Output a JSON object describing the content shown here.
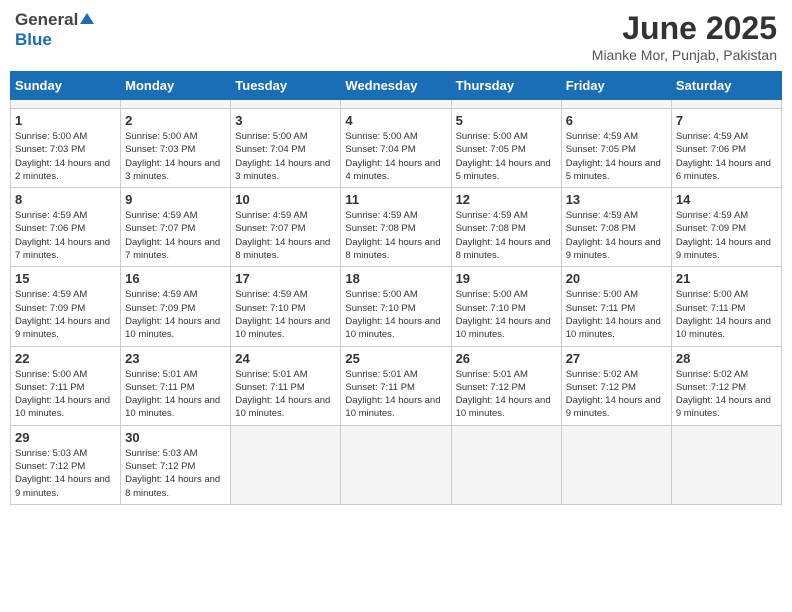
{
  "header": {
    "logo_general": "General",
    "logo_blue": "Blue",
    "month_title": "June 2025",
    "location": "Mianke Mor, Punjab, Pakistan"
  },
  "calendar": {
    "days_of_week": [
      "Sunday",
      "Monday",
      "Tuesday",
      "Wednesday",
      "Thursday",
      "Friday",
      "Saturday"
    ],
    "weeks": [
      [
        {
          "day": null,
          "empty": true
        },
        {
          "day": null,
          "empty": true
        },
        {
          "day": null,
          "empty": true
        },
        {
          "day": null,
          "empty": true
        },
        {
          "day": null,
          "empty": true
        },
        {
          "day": null,
          "empty": true
        },
        {
          "day": null,
          "empty": true
        }
      ],
      [
        {
          "day": 1,
          "sunrise": "5:00 AM",
          "sunset": "7:03 PM",
          "daylight": "14 hours and 2 minutes."
        },
        {
          "day": 2,
          "sunrise": "5:00 AM",
          "sunset": "7:03 PM",
          "daylight": "14 hours and 3 minutes."
        },
        {
          "day": 3,
          "sunrise": "5:00 AM",
          "sunset": "7:04 PM",
          "daylight": "14 hours and 3 minutes."
        },
        {
          "day": 4,
          "sunrise": "5:00 AM",
          "sunset": "7:04 PM",
          "daylight": "14 hours and 4 minutes."
        },
        {
          "day": 5,
          "sunrise": "5:00 AM",
          "sunset": "7:05 PM",
          "daylight": "14 hours and 5 minutes."
        },
        {
          "day": 6,
          "sunrise": "4:59 AM",
          "sunset": "7:05 PM",
          "daylight": "14 hours and 5 minutes."
        },
        {
          "day": 7,
          "sunrise": "4:59 AM",
          "sunset": "7:06 PM",
          "daylight": "14 hours and 6 minutes."
        }
      ],
      [
        {
          "day": 8,
          "sunrise": "4:59 AM",
          "sunset": "7:06 PM",
          "daylight": "14 hours and 7 minutes."
        },
        {
          "day": 9,
          "sunrise": "4:59 AM",
          "sunset": "7:07 PM",
          "daylight": "14 hours and 7 minutes."
        },
        {
          "day": 10,
          "sunrise": "4:59 AM",
          "sunset": "7:07 PM",
          "daylight": "14 hours and 8 minutes."
        },
        {
          "day": 11,
          "sunrise": "4:59 AM",
          "sunset": "7:08 PM",
          "daylight": "14 hours and 8 minutes."
        },
        {
          "day": 12,
          "sunrise": "4:59 AM",
          "sunset": "7:08 PM",
          "daylight": "14 hours and 8 minutes."
        },
        {
          "day": 13,
          "sunrise": "4:59 AM",
          "sunset": "7:08 PM",
          "daylight": "14 hours and 9 minutes."
        },
        {
          "day": 14,
          "sunrise": "4:59 AM",
          "sunset": "7:09 PM",
          "daylight": "14 hours and 9 minutes."
        }
      ],
      [
        {
          "day": 15,
          "sunrise": "4:59 AM",
          "sunset": "7:09 PM",
          "daylight": "14 hours and 9 minutes."
        },
        {
          "day": 16,
          "sunrise": "4:59 AM",
          "sunset": "7:09 PM",
          "daylight": "14 hours and 10 minutes."
        },
        {
          "day": 17,
          "sunrise": "4:59 AM",
          "sunset": "7:10 PM",
          "daylight": "14 hours and 10 minutes."
        },
        {
          "day": 18,
          "sunrise": "5:00 AM",
          "sunset": "7:10 PM",
          "daylight": "14 hours and 10 minutes."
        },
        {
          "day": 19,
          "sunrise": "5:00 AM",
          "sunset": "7:10 PM",
          "daylight": "14 hours and 10 minutes."
        },
        {
          "day": 20,
          "sunrise": "5:00 AM",
          "sunset": "7:11 PM",
          "daylight": "14 hours and 10 minutes."
        },
        {
          "day": 21,
          "sunrise": "5:00 AM",
          "sunset": "7:11 PM",
          "daylight": "14 hours and 10 minutes."
        }
      ],
      [
        {
          "day": 22,
          "sunrise": "5:00 AM",
          "sunset": "7:11 PM",
          "daylight": "14 hours and 10 minutes."
        },
        {
          "day": 23,
          "sunrise": "5:01 AM",
          "sunset": "7:11 PM",
          "daylight": "14 hours and 10 minutes."
        },
        {
          "day": 24,
          "sunrise": "5:01 AM",
          "sunset": "7:11 PM",
          "daylight": "14 hours and 10 minutes."
        },
        {
          "day": 25,
          "sunrise": "5:01 AM",
          "sunset": "7:11 PM",
          "daylight": "14 hours and 10 minutes."
        },
        {
          "day": 26,
          "sunrise": "5:01 AM",
          "sunset": "7:12 PM",
          "daylight": "14 hours and 10 minutes."
        },
        {
          "day": 27,
          "sunrise": "5:02 AM",
          "sunset": "7:12 PM",
          "daylight": "14 hours and 9 minutes."
        },
        {
          "day": 28,
          "sunrise": "5:02 AM",
          "sunset": "7:12 PM",
          "daylight": "14 hours and 9 minutes."
        }
      ],
      [
        {
          "day": 29,
          "sunrise": "5:03 AM",
          "sunset": "7:12 PM",
          "daylight": "14 hours and 9 minutes."
        },
        {
          "day": 30,
          "sunrise": "5:03 AM",
          "sunset": "7:12 PM",
          "daylight": "14 hours and 8 minutes."
        },
        null,
        null,
        null,
        null,
        null
      ]
    ]
  }
}
